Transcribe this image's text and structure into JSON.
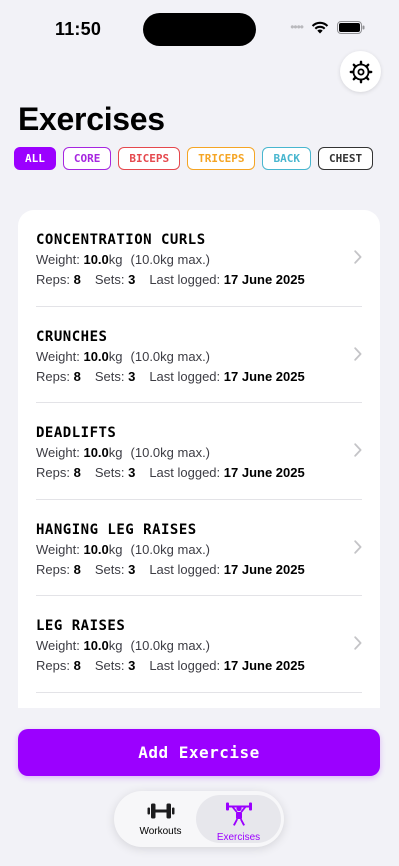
{
  "status": {
    "time": "11:50"
  },
  "header": {
    "title": "Exercises"
  },
  "icons": {
    "settings": "settings-gear-icon",
    "chevron": "chevron-right-icon",
    "workouts": "dumbbell-icon",
    "exercises": "weightlifter-icon"
  },
  "colors": {
    "accent": "#9b00ff",
    "core": "#a626e0",
    "biceps": "#e5484d",
    "triceps": "#f5a524",
    "back": "#48b6cf",
    "chest": "#333333"
  },
  "filters": [
    {
      "label": "ALL",
      "color": "#9b00ff",
      "active": true
    },
    {
      "label": "CORE",
      "color": "#a626e0",
      "active": false
    },
    {
      "label": "BICEPS",
      "color": "#e5484d",
      "active": false
    },
    {
      "label": "TRICEPS",
      "color": "#f5a524",
      "active": false
    },
    {
      "label": "BACK",
      "color": "#48b6cf",
      "active": false
    },
    {
      "label": "CHEST",
      "color": "#333333",
      "active": false
    }
  ],
  "labels": {
    "weight": "Weight:",
    "unit": "kg",
    "max_open": "(",
    "max_close": "kg max.)",
    "reps": "Reps:",
    "sets": "Sets:",
    "last_logged": "Last logged:"
  },
  "exercises": [
    {
      "name": "CONCENTRATION CURLS",
      "weight": "10.0",
      "max": "10.0",
      "reps": "8",
      "sets": "3",
      "last_logged": "17 June 2025"
    },
    {
      "name": "CRUNCHES",
      "weight": "10.0",
      "max": "10.0",
      "reps": "8",
      "sets": "3",
      "last_logged": "17 June 2025"
    },
    {
      "name": "DEADLIFTS",
      "weight": "10.0",
      "max": "10.0",
      "reps": "8",
      "sets": "3",
      "last_logged": "17 June 2025"
    },
    {
      "name": "HANGING LEG RAISES",
      "weight": "10.0",
      "max": "10.0",
      "reps": "8",
      "sets": "3",
      "last_logged": "17 June 2025"
    },
    {
      "name": "LEG RAISES",
      "weight": "10.0",
      "max": "10.0",
      "reps": "8",
      "sets": "3",
      "last_logged": "17 June 2025"
    }
  ],
  "actions": {
    "add_exercise": "Add Exercise"
  },
  "tabs": [
    {
      "label": "Workouts",
      "selected": false
    },
    {
      "label": "Exercises",
      "selected": true
    }
  ]
}
